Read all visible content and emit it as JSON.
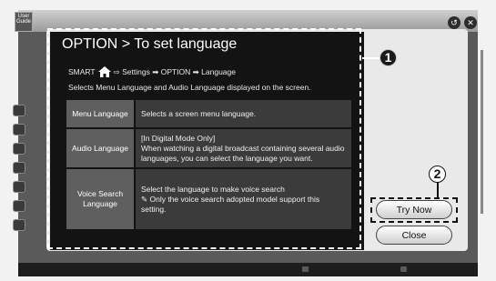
{
  "user_guide": {
    "line1": "User",
    "line2": "Guide"
  },
  "dialog": {
    "title": "OPTION > To set language",
    "path": {
      "prefix": "SMART",
      "arrow1": "⇨",
      "step1": "Settings",
      "arrow2": "➡",
      "step2": "OPTION",
      "arrow3": "➡",
      "step3": "Language"
    },
    "description": "Selects Menu Language and Audio Language displayed on the screen.",
    "rows": [
      {
        "key": "Menu Language",
        "value_lines": [
          "Selects a screen menu language."
        ]
      },
      {
        "key": "Audio Language",
        "value_lines": [
          "[In Digital Mode Only]",
          "When watching a digital broadcast containing several audio languages, you can select the language you want."
        ]
      },
      {
        "key": "Voice Search Language",
        "value_lines": [
          "Select the language to make voice search",
          "✎ Only the voice search adopted model support this setting."
        ]
      }
    ]
  },
  "buttons": {
    "try_now": "Try Now",
    "close": "Close"
  },
  "callouts": {
    "one": "1",
    "two": "2"
  },
  "icons": {
    "back": "↺",
    "close": "✕"
  }
}
